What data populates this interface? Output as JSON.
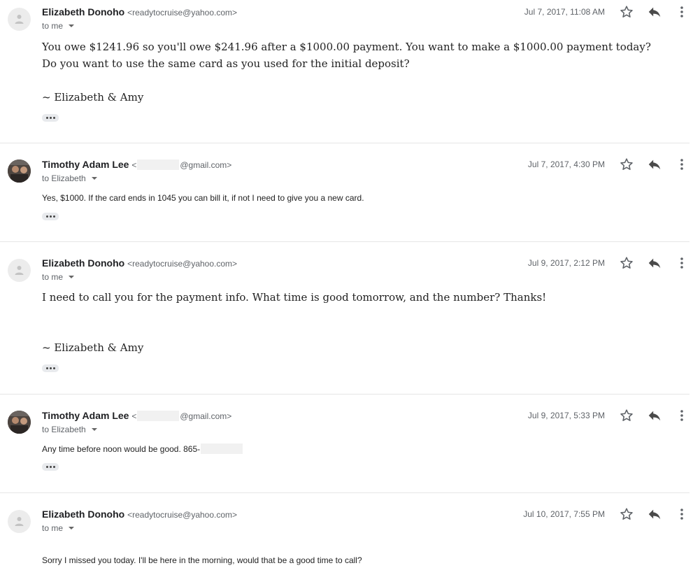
{
  "messages": [
    {
      "sender_name": "Elizabeth Donoho",
      "sender_email": "<readytocruise@yahoo.com>",
      "to": "to me",
      "date": "Jul 7, 2017, 11:08 AM",
      "body_lines": [
        "You owe $1241.96 so you'll owe $241.96 after a $1000.00 payment. You want to make a $1000.00 payment today?",
        "Do you want to use the same card as you used for the initial deposit?",
        "",
        "~ Elizabeth & Amy"
      ]
    },
    {
      "sender_name": "Timothy Adam Lee",
      "sender_email_prefix": "<",
      "sender_email_suffix": "@gmail.com>",
      "to": "to Elizabeth",
      "date": "Jul 7, 2017, 4:30 PM",
      "body_lines": [
        "Yes, $1000.  If the card ends in 1045 you can bill it, if not I need to give you a new card."
      ]
    },
    {
      "sender_name": "Elizabeth Donoho",
      "sender_email": "<readytocruise@yahoo.com>",
      "to": "to me",
      "date": "Jul 9, 2017, 2:12 PM",
      "body_lines": [
        "I need to call you for the payment info. What time is good tomorrow, and the number? Thanks!",
        "~ Elizabeth & Amy"
      ]
    },
    {
      "sender_name": "Timothy Adam Lee",
      "sender_email_prefix": "<",
      "sender_email_suffix": "@gmail.com>",
      "to": "to Elizabeth",
      "date": "Jul 9, 2017, 5:33 PM",
      "body_lines": [
        "Any time before noon would be good.  865-"
      ]
    },
    {
      "sender_name": "Elizabeth Donoho",
      "sender_email": "<readytocruise@yahoo.com>",
      "to": "to me",
      "date": "Jul 10, 2017, 7:55 PM",
      "body_lines": [
        "Sorry I missed you today. I'll be here in the morning, would that be a good time to call?"
      ]
    }
  ],
  "icons": {
    "star": "star-icon",
    "reply": "reply-icon",
    "more": "more-vert-icon",
    "expand": "ellipsis-icon",
    "avatar_default": "person-icon"
  },
  "colors": {
    "text_primary": "#202124",
    "text_secondary": "#5f6368",
    "divider": "#e6e6e6",
    "chip_bg": "#e8eaed"
  }
}
